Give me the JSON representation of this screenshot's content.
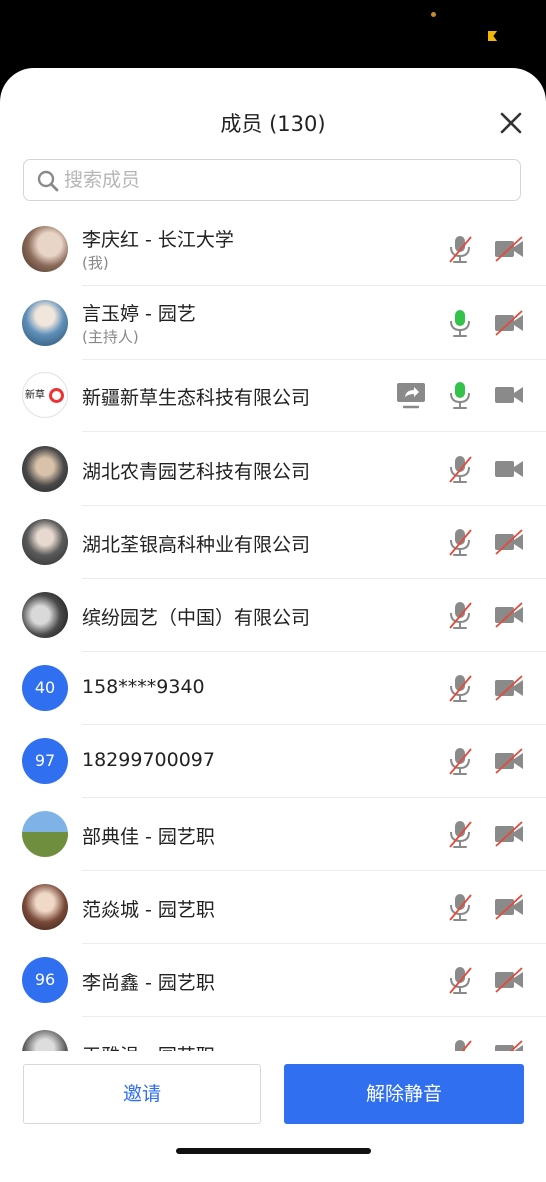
{
  "header": {
    "title": "成员 (130)"
  },
  "search": {
    "placeholder": "搜索成员",
    "value": ""
  },
  "members": [
    {
      "name": "李庆红 - 长江大学",
      "role": "(我)",
      "avatar": "photo",
      "mic": "muted",
      "camera": "off"
    },
    {
      "name": "言玉婷 - 园艺",
      "role": "(主持人)",
      "avatar": "photo",
      "mic": "active",
      "camera": "off"
    },
    {
      "name": "新疆新草生态科技有限公司",
      "role": "",
      "avatar": "logo",
      "avatar_logo_text": "新草",
      "share_screen": true,
      "mic": "active",
      "camera": "on"
    },
    {
      "name": "湖北农青园艺科技有限公司",
      "role": "",
      "avatar": "photo",
      "mic": "muted",
      "camera": "on"
    },
    {
      "name": "湖北荃银高科种业有限公司",
      "role": "",
      "avatar": "photo",
      "mic": "muted",
      "camera": "off"
    },
    {
      "name": "缤纷园艺（中国）有限公司",
      "role": "",
      "avatar": "photo",
      "mic": "muted",
      "camera": "off"
    },
    {
      "name": "158****9340",
      "role": "",
      "avatar": "number",
      "avatar_text": "40",
      "mic": "muted",
      "camera": "off"
    },
    {
      "name": "18299700097",
      "role": "",
      "avatar": "number",
      "avatar_text": "97",
      "mic": "muted",
      "camera": "off"
    },
    {
      "name": "部典佳 - 园艺职",
      "role": "",
      "avatar": "photo",
      "mic": "muted",
      "camera": "off"
    },
    {
      "name": "范焱城 - 园艺职",
      "role": "",
      "avatar": "photo",
      "mic": "muted",
      "camera": "off"
    },
    {
      "name": "李尚鑫 - 园艺职",
      "role": "",
      "avatar": "number",
      "avatar_text": "96",
      "mic": "muted",
      "camera": "off"
    },
    {
      "name": "王雅涓 - 园艺职",
      "role": "",
      "avatar": "photo",
      "mic": "muted",
      "camera": "off"
    }
  ],
  "footer": {
    "invite_label": "邀请",
    "unmute_label": "解除静音"
  },
  "colors": {
    "accent": "#2f6ff0",
    "muted_slash": "#e24a3b",
    "active_mic": "#35c24a",
    "icon_gray": "#8a8a8a"
  }
}
